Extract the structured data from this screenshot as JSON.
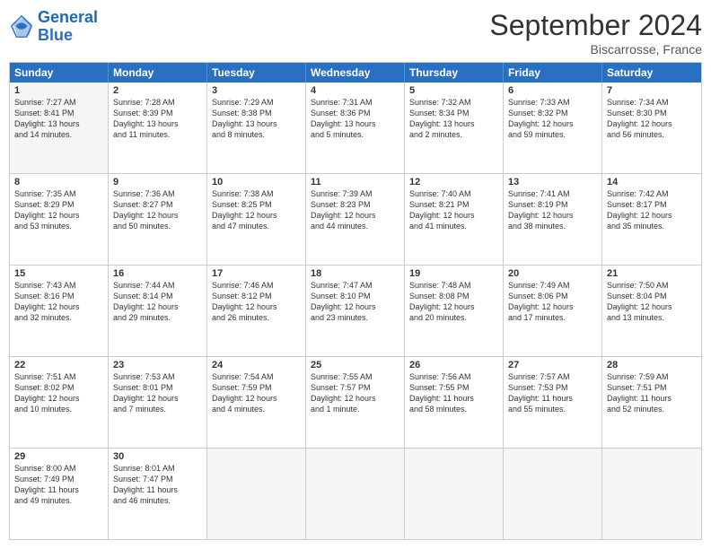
{
  "header": {
    "logo_general": "General",
    "logo_blue": "Blue",
    "title": "September 2024",
    "location": "Biscarrosse, France"
  },
  "days_of_week": [
    "Sunday",
    "Monday",
    "Tuesday",
    "Wednesday",
    "Thursday",
    "Friday",
    "Saturday"
  ],
  "rows": [
    [
      {
        "day": "",
        "empty": true,
        "lines": []
      },
      {
        "day": "2",
        "empty": false,
        "lines": [
          "Sunrise: 7:28 AM",
          "Sunset: 8:39 PM",
          "Daylight: 13 hours",
          "and 11 minutes."
        ]
      },
      {
        "day": "3",
        "empty": false,
        "lines": [
          "Sunrise: 7:29 AM",
          "Sunset: 8:38 PM",
          "Daylight: 13 hours",
          "and 8 minutes."
        ]
      },
      {
        "day": "4",
        "empty": false,
        "lines": [
          "Sunrise: 7:31 AM",
          "Sunset: 8:36 PM",
          "Daylight: 13 hours",
          "and 5 minutes."
        ]
      },
      {
        "day": "5",
        "empty": false,
        "lines": [
          "Sunrise: 7:32 AM",
          "Sunset: 8:34 PM",
          "Daylight: 13 hours",
          "and 2 minutes."
        ]
      },
      {
        "day": "6",
        "empty": false,
        "lines": [
          "Sunrise: 7:33 AM",
          "Sunset: 8:32 PM",
          "Daylight: 12 hours",
          "and 59 minutes."
        ]
      },
      {
        "day": "7",
        "empty": false,
        "lines": [
          "Sunrise: 7:34 AM",
          "Sunset: 8:30 PM",
          "Daylight: 12 hours",
          "and 56 minutes."
        ]
      }
    ],
    [
      {
        "day": "8",
        "empty": false,
        "lines": [
          "Sunrise: 7:35 AM",
          "Sunset: 8:29 PM",
          "Daylight: 12 hours",
          "and 53 minutes."
        ]
      },
      {
        "day": "9",
        "empty": false,
        "lines": [
          "Sunrise: 7:36 AM",
          "Sunset: 8:27 PM",
          "Daylight: 12 hours",
          "and 50 minutes."
        ]
      },
      {
        "day": "10",
        "empty": false,
        "lines": [
          "Sunrise: 7:38 AM",
          "Sunset: 8:25 PM",
          "Daylight: 12 hours",
          "and 47 minutes."
        ]
      },
      {
        "day": "11",
        "empty": false,
        "lines": [
          "Sunrise: 7:39 AM",
          "Sunset: 8:23 PM",
          "Daylight: 12 hours",
          "and 44 minutes."
        ]
      },
      {
        "day": "12",
        "empty": false,
        "lines": [
          "Sunrise: 7:40 AM",
          "Sunset: 8:21 PM",
          "Daylight: 12 hours",
          "and 41 minutes."
        ]
      },
      {
        "day": "13",
        "empty": false,
        "lines": [
          "Sunrise: 7:41 AM",
          "Sunset: 8:19 PM",
          "Daylight: 12 hours",
          "and 38 minutes."
        ]
      },
      {
        "day": "14",
        "empty": false,
        "lines": [
          "Sunrise: 7:42 AM",
          "Sunset: 8:17 PM",
          "Daylight: 12 hours",
          "and 35 minutes."
        ]
      }
    ],
    [
      {
        "day": "15",
        "empty": false,
        "lines": [
          "Sunrise: 7:43 AM",
          "Sunset: 8:16 PM",
          "Daylight: 12 hours",
          "and 32 minutes."
        ]
      },
      {
        "day": "16",
        "empty": false,
        "lines": [
          "Sunrise: 7:44 AM",
          "Sunset: 8:14 PM",
          "Daylight: 12 hours",
          "and 29 minutes."
        ]
      },
      {
        "day": "17",
        "empty": false,
        "lines": [
          "Sunrise: 7:46 AM",
          "Sunset: 8:12 PM",
          "Daylight: 12 hours",
          "and 26 minutes."
        ]
      },
      {
        "day": "18",
        "empty": false,
        "lines": [
          "Sunrise: 7:47 AM",
          "Sunset: 8:10 PM",
          "Daylight: 12 hours",
          "and 23 minutes."
        ]
      },
      {
        "day": "19",
        "empty": false,
        "lines": [
          "Sunrise: 7:48 AM",
          "Sunset: 8:08 PM",
          "Daylight: 12 hours",
          "and 20 minutes."
        ]
      },
      {
        "day": "20",
        "empty": false,
        "lines": [
          "Sunrise: 7:49 AM",
          "Sunset: 8:06 PM",
          "Daylight: 12 hours",
          "and 17 minutes."
        ]
      },
      {
        "day": "21",
        "empty": false,
        "lines": [
          "Sunrise: 7:50 AM",
          "Sunset: 8:04 PM",
          "Daylight: 12 hours",
          "and 13 minutes."
        ]
      }
    ],
    [
      {
        "day": "22",
        "empty": false,
        "lines": [
          "Sunrise: 7:51 AM",
          "Sunset: 8:02 PM",
          "Daylight: 12 hours",
          "and 10 minutes."
        ]
      },
      {
        "day": "23",
        "empty": false,
        "lines": [
          "Sunrise: 7:53 AM",
          "Sunset: 8:01 PM",
          "Daylight: 12 hours",
          "and 7 minutes."
        ]
      },
      {
        "day": "24",
        "empty": false,
        "lines": [
          "Sunrise: 7:54 AM",
          "Sunset: 7:59 PM",
          "Daylight: 12 hours",
          "and 4 minutes."
        ]
      },
      {
        "day": "25",
        "empty": false,
        "lines": [
          "Sunrise: 7:55 AM",
          "Sunset: 7:57 PM",
          "Daylight: 12 hours",
          "and 1 minute."
        ]
      },
      {
        "day": "26",
        "empty": false,
        "lines": [
          "Sunrise: 7:56 AM",
          "Sunset: 7:55 PM",
          "Daylight: 11 hours",
          "and 58 minutes."
        ]
      },
      {
        "day": "27",
        "empty": false,
        "lines": [
          "Sunrise: 7:57 AM",
          "Sunset: 7:53 PM",
          "Daylight: 11 hours",
          "and 55 minutes."
        ]
      },
      {
        "day": "28",
        "empty": false,
        "lines": [
          "Sunrise: 7:59 AM",
          "Sunset: 7:51 PM",
          "Daylight: 11 hours",
          "and 52 minutes."
        ]
      }
    ],
    [
      {
        "day": "29",
        "empty": false,
        "lines": [
          "Sunrise: 8:00 AM",
          "Sunset: 7:49 PM",
          "Daylight: 11 hours",
          "and 49 minutes."
        ]
      },
      {
        "day": "30",
        "empty": false,
        "lines": [
          "Sunrise: 8:01 AM",
          "Sunset: 7:47 PM",
          "Daylight: 11 hours",
          "and 46 minutes."
        ]
      },
      {
        "day": "",
        "empty": true,
        "lines": []
      },
      {
        "day": "",
        "empty": true,
        "lines": []
      },
      {
        "day": "",
        "empty": true,
        "lines": []
      },
      {
        "day": "",
        "empty": true,
        "lines": []
      },
      {
        "day": "",
        "empty": true,
        "lines": []
      }
    ]
  ],
  "first_row_day1": {
    "day": "1",
    "lines": [
      "Sunrise: 7:27 AM",
      "Sunset: 8:41 PM",
      "Daylight: 13 hours",
      "and 14 minutes."
    ]
  }
}
